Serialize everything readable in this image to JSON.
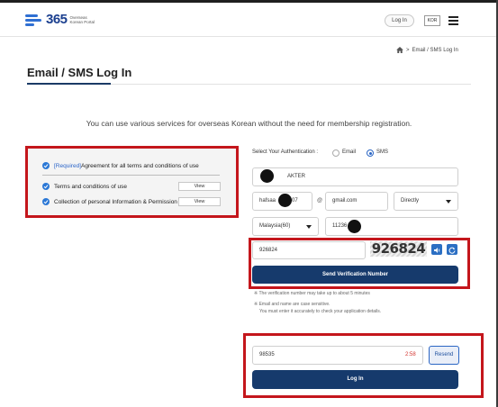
{
  "header": {
    "logo_number": "365",
    "logo_line1": "Overseas",
    "logo_line2": "Korean Portal",
    "login_label": "Log In",
    "lang_label": "KOR"
  },
  "breadcrumb": {
    "separator": ">",
    "current": "Email / SMS Log In"
  },
  "page_title": "Email / SMS Log In",
  "intro_text": "You can use various services for overseas Korean without the need for membership registration.",
  "agreements": {
    "all": {
      "required_tag": "[Required]",
      "label": " Agreement for all terms and conditions of use"
    },
    "items": [
      {
        "label": "Terms and conditions of use",
        "view_label": "View"
      },
      {
        "label": "Collection of personal Information & Permission",
        "view_label": "View"
      }
    ]
  },
  "auth": {
    "label": "Select Your Authentication :",
    "options": [
      {
        "label": "Email",
        "selected": false
      },
      {
        "label": "SMS",
        "selected": true
      }
    ]
  },
  "form": {
    "name_value": "AKTER",
    "email_local": "hafsaa",
    "email_local_tail": "07",
    "email_at": "@",
    "email_domain": "gmail.com",
    "email_select": "Directly",
    "country_select": "Malaysia(60)",
    "phone_value": "11236"
  },
  "captcha": {
    "input_value": "926824",
    "image_text": "926824",
    "send_label": "Send Verification Number",
    "note1": "※ The verification number may take up to about 5 minutes",
    "note2": "※ Email and name are case sensitive.",
    "note3": "You must enter it accurately to check your application details."
  },
  "verify": {
    "code_value": "98535",
    "timer": "2:58",
    "resend_label": "Resend",
    "login_label": "Log In"
  },
  "colors": {
    "navy": "#163a6c",
    "accent_blue": "#2b66c4",
    "highlight_red": "#c4161c",
    "timer_red": "#d3342f"
  }
}
